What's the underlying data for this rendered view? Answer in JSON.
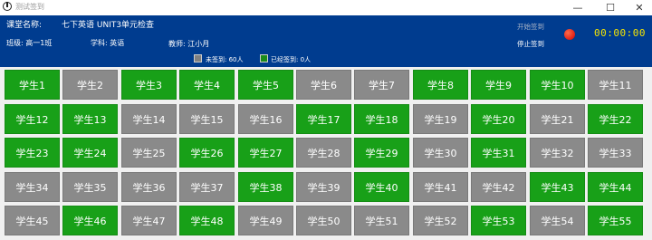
{
  "window": {
    "title": "测试签到",
    "min": "—",
    "max": "☐",
    "close": "✕"
  },
  "header": {
    "course_label": "课堂名称:",
    "course_value": "七下英语 UNIT3单元检查",
    "class_label": "班级: 高一1班",
    "subject_label": "学科: 英语",
    "teacher_label": "教师: 江小月",
    "start_button": "开始签到",
    "stop_button": "停止签到",
    "timer": "00:00:00"
  },
  "legend": {
    "absent": "未签到: 60人",
    "present": "已经签到: 0人",
    "absent_color": "#808080",
    "present_color": "#1a8c1a"
  },
  "students": [
    {
      "name": "学生1",
      "present": true
    },
    {
      "name": "学生2",
      "present": false
    },
    {
      "name": "学生3",
      "present": true
    },
    {
      "name": "学生4",
      "present": true
    },
    {
      "name": "学生5",
      "present": true
    },
    {
      "name": "学生6",
      "present": false
    },
    {
      "name": "学生7",
      "present": false
    },
    {
      "name": "学生8",
      "present": true
    },
    {
      "name": "学生9",
      "present": true
    },
    {
      "name": "学生10",
      "present": true
    },
    {
      "name": "学生11",
      "present": false
    },
    {
      "name": "学生12",
      "present": true
    },
    {
      "name": "学生13",
      "present": true
    },
    {
      "name": "学生14",
      "present": false
    },
    {
      "name": "学生15",
      "present": false
    },
    {
      "name": "学生16",
      "present": false
    },
    {
      "name": "学生17",
      "present": true
    },
    {
      "name": "学生18",
      "present": true
    },
    {
      "name": "学生19",
      "present": false
    },
    {
      "name": "学生20",
      "present": true
    },
    {
      "name": "学生21",
      "present": false
    },
    {
      "name": "学生22",
      "present": true
    },
    {
      "name": "学生23",
      "present": true
    },
    {
      "name": "学生24",
      "present": true
    },
    {
      "name": "学生25",
      "present": false
    },
    {
      "name": "学生26",
      "present": true
    },
    {
      "name": "学生27",
      "present": true
    },
    {
      "name": "学生28",
      "present": false
    },
    {
      "name": "学生29",
      "present": true
    },
    {
      "name": "学生30",
      "present": false
    },
    {
      "name": "学生31",
      "present": true
    },
    {
      "name": "学生32",
      "present": false
    },
    {
      "name": "学生33",
      "present": false
    },
    {
      "name": "学生34",
      "present": false
    },
    {
      "name": "学生35",
      "present": false
    },
    {
      "name": "学生36",
      "present": false
    },
    {
      "name": "学生37",
      "present": false
    },
    {
      "name": "学生38",
      "present": true
    },
    {
      "name": "学生39",
      "present": false
    },
    {
      "name": "学生40",
      "present": true
    },
    {
      "name": "学生41",
      "present": false
    },
    {
      "name": "学生42",
      "present": false
    },
    {
      "name": "学生43",
      "present": true
    },
    {
      "name": "学生44",
      "present": true
    },
    {
      "name": "学生45",
      "present": false
    },
    {
      "name": "学生46",
      "present": true
    },
    {
      "name": "学生47",
      "present": false
    },
    {
      "name": "学生48",
      "present": true
    },
    {
      "name": "学生49",
      "present": false
    },
    {
      "name": "学生50",
      "present": false
    },
    {
      "name": "学生51",
      "present": false
    },
    {
      "name": "学生52",
      "present": false
    },
    {
      "name": "学生53",
      "present": true
    },
    {
      "name": "学生54",
      "present": false
    },
    {
      "name": "学生55",
      "present": true
    }
  ]
}
